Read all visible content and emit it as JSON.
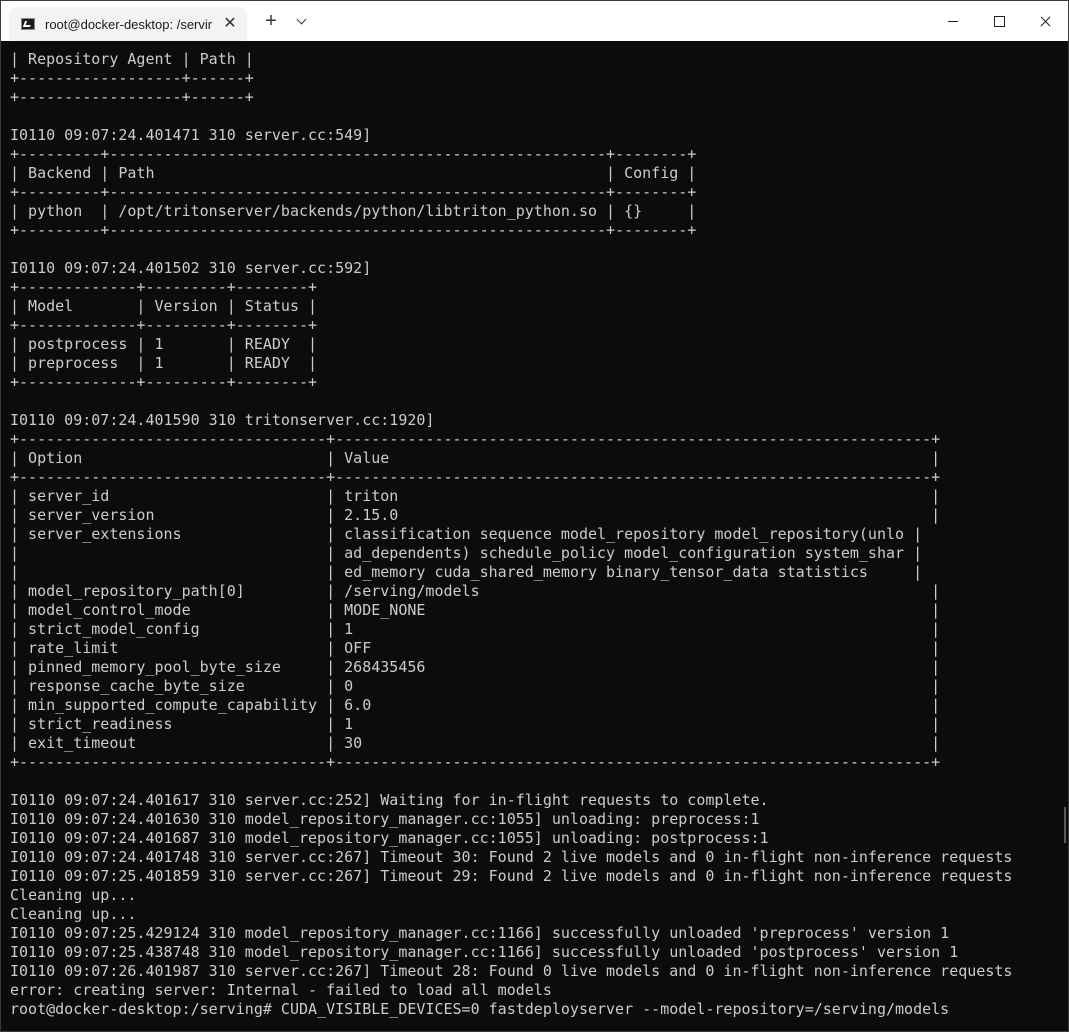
{
  "window": {
    "tab_title": "root@docker-desktop: /servir",
    "tab_icon": "terminal-icon",
    "close_tab_glyph": "✕",
    "new_tab_glyph": "+",
    "dropdown_icon": "chevron-down-icon",
    "minimize_icon": "minimize-icon",
    "maximize_icon": "maximize-icon",
    "close_icon": "close-icon"
  },
  "colors": {
    "background": "#0c0c0c",
    "text": "#cccccc",
    "titlebar": "#ffffff"
  },
  "terminal": {
    "lines": [
      "| Repository Agent | Path |",
      "+------------------+------+",
      "+------------------+------+",
      "",
      "I0110 09:07:24.401471 310 server.cc:549]",
      "+---------+-------------------------------------------------------+--------+",
      "| Backend | Path                                                  | Config |",
      "+---------+-------------------------------------------------------+--------+",
      "| python  | /opt/tritonserver/backends/python/libtriton_python.so | {}     |",
      "+---------+-------------------------------------------------------+--------+",
      "",
      "I0110 09:07:24.401502 310 server.cc:592]",
      "+-------------+---------+--------+",
      "| Model       | Version | Status |",
      "+-------------+---------+--------+",
      "| postprocess | 1       | READY  |",
      "| preprocess  | 1       | READY  |",
      "+-------------+---------+--------+",
      "",
      "I0110 09:07:24.401590 310 tritonserver.cc:1920]",
      "+----------------------------------+------------------------------------------------------------------+",
      "| Option                           | Value                                                            |",
      "+----------------------------------+------------------------------------------------------------------+",
      "| server_id                        | triton                                                           |",
      "| server_version                   | 2.15.0                                                           |",
      "| server_extensions                | classification sequence model_repository model_repository(unlo |",
      "|                                  | ad_dependents) schedule_policy model_configuration system_shar |",
      "|                                  | ed_memory cuda_shared_memory binary_tensor_data statistics     |",
      "| model_repository_path[0]         | /serving/models                                                  |",
      "| model_control_mode               | MODE_NONE                                                        |",
      "| strict_model_config              | 1                                                                |",
      "| rate_limit                       | OFF                                                              |",
      "| pinned_memory_pool_byte_size     | 268435456                                                        |",
      "| response_cache_byte_size         | 0                                                                |",
      "| min_supported_compute_capability | 6.0                                                              |",
      "| strict_readiness                 | 1                                                                |",
      "| exit_timeout                     | 30                                                               |",
      "+----------------------------------+------------------------------------------------------------------+",
      "",
      "I0110 09:07:24.401617 310 server.cc:252] Waiting for in-flight requests to complete.",
      "I0110 09:07:24.401630 310 model_repository_manager.cc:1055] unloading: preprocess:1",
      "I0110 09:07:24.401687 310 model_repository_manager.cc:1055] unloading: postprocess:1",
      "I0110 09:07:24.401748 310 server.cc:267] Timeout 30: Found 2 live models and 0 in-flight non-inference requests",
      "I0110 09:07:25.401859 310 server.cc:267] Timeout 29: Found 2 live models and 0 in-flight non-inference requests",
      "Cleaning up...",
      "Cleaning up...",
      "I0110 09:07:25.429124 310 model_repository_manager.cc:1166] successfully unloaded 'preprocess' version 1",
      "I0110 09:07:25.438748 310 model_repository_manager.cc:1166] successfully unloaded 'postprocess' version 1",
      "I0110 09:07:26.401987 310 server.cc:267] Timeout 28: Found 0 live models and 0 in-flight non-inference requests",
      "error: creating server: Internal - failed to load all models",
      "root@docker-desktop:/serving# CUDA_VISIBLE_DEVICES=0 fastdeployserver --model-repository=/serving/models"
    ]
  }
}
